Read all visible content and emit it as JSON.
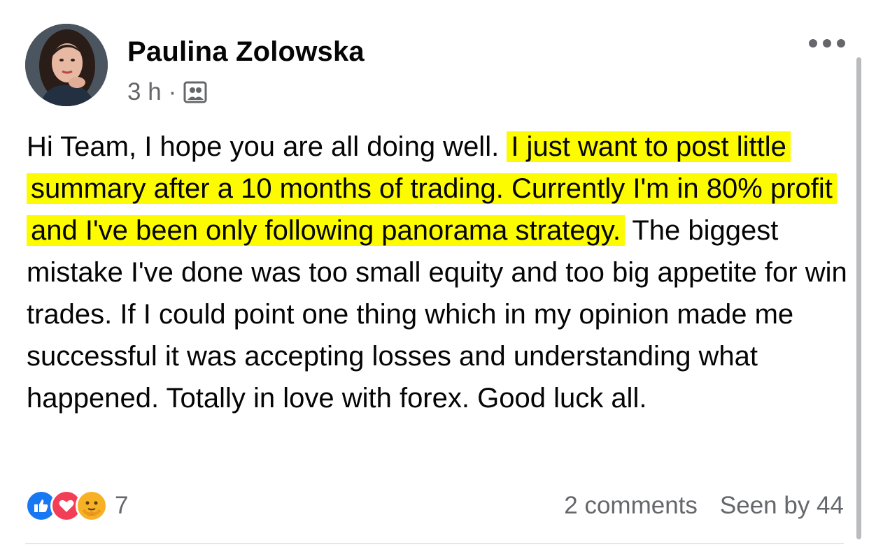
{
  "post": {
    "author": "Paulina Zolowska",
    "time": "3 h",
    "separator": "·",
    "audience_icon": "group-icon",
    "body": {
      "intro": "Hi Team, I hope you are all doing well.",
      "highlight": "I just want to post little summary after a 10 months of trading. Currently I'm in 80% profit and I've been only following panorama strategy.",
      "rest": "The biggest mistake I've done was too small equity and too big appetite for win trades. If I could point one thing which in my opinion made me successful it was accepting losses and understanding what happened. Totally in love with forex. Good luck all."
    },
    "highlight_color": "#fdfb00"
  },
  "footer": {
    "reactions": [
      "like-icon",
      "love-icon",
      "care-icon"
    ],
    "reaction_count": "7",
    "comments": "2 comments",
    "seen": "Seen by 44"
  },
  "colors": {
    "like": "#1877f2",
    "love": "#f33e58",
    "care": "#f7b125",
    "secondary_text": "#65676b"
  }
}
